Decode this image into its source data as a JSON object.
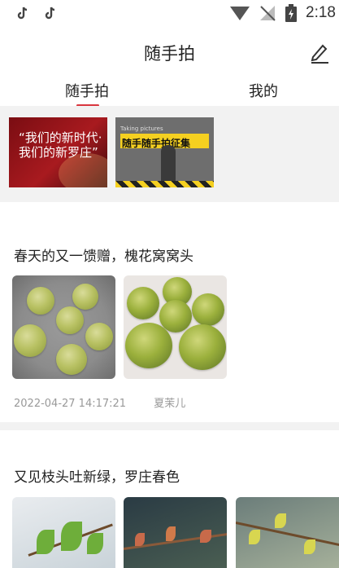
{
  "status_bar": {
    "time": "2:18",
    "left_icons": [
      "tiktok-icon",
      "tiktok-icon"
    ],
    "right_icons": [
      "wifi-icon",
      "signal-icon",
      "battery-charging-icon"
    ]
  },
  "header": {
    "title": "随手拍",
    "edit_icon": "edit-icon"
  },
  "tabs": [
    {
      "label": "随手拍",
      "active": true
    },
    {
      "label": "我的",
      "active": false
    }
  ],
  "banners": [
    {
      "text": "“我们的新时代·我们的新罗庄”"
    },
    {
      "top_text": "Taking pictures",
      "text": "随手随手拍征集"
    }
  ],
  "posts": [
    {
      "title": "春天的又一馈赠，槐花窝窝头",
      "timestamp": "2022-04-27 14:17:21",
      "author": "夏茉儿"
    },
    {
      "title": "又见枝头吐新绿，罗庄春色"
    }
  ],
  "colors": {
    "accent": "#d9363e",
    "background": "#ffffff",
    "separator": "#f2f2f2",
    "meta_text": "#999999"
  }
}
